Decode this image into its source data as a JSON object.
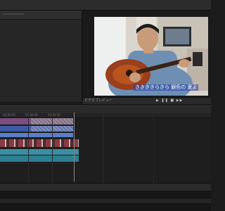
{
  "viewer": {
    "label": "ビデオプレビュー",
    "caption": "ききききらきら 銀色の 夏よ",
    "controls": "▶ ❚❚ ■ ▶▶"
  },
  "timeline": {
    "ruler_ticks": [
      "00:00:00",
      "00:00:05",
      "00:00:10"
    ]
  },
  "colors": {
    "video_track": "#7a4e7e",
    "audio_track": "#3d5aa8",
    "thumb_track": "#8a3a42",
    "music_track": "#3a8fa3",
    "track_label_blue": "#5a7ec8"
  }
}
